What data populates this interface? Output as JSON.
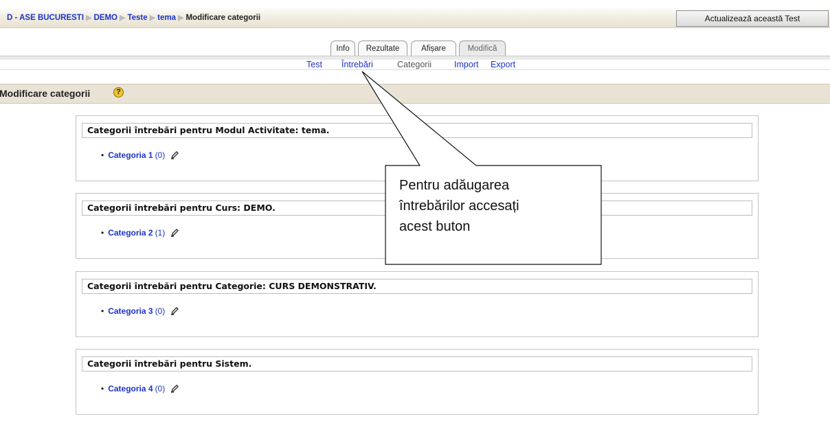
{
  "breadcrumb": {
    "items": [
      "D - ASE BUCURESTI",
      "DEMO",
      "Teste",
      "tema"
    ],
    "current": "Modificare categorii"
  },
  "header": {
    "update_button": "Actualizează această Test"
  },
  "tabs": [
    "Info",
    "Rezultate",
    "Afișare",
    "Modifică"
  ],
  "subtabs": [
    "Test",
    "Întrebări",
    "Categorii",
    "Import",
    "Export"
  ],
  "page_title": "Modificare categorii",
  "help_icon": "?",
  "sections": [
    {
      "title": "Categorii întrebări pentru Modul Activitate: tema.",
      "category": "Categoria 1",
      "count": "(0)"
    },
    {
      "title": "Categorii întrebări pentru Curs: DEMO.",
      "category": "Categoria 2",
      "count": "(1)"
    },
    {
      "title": "Categorii întrebări pentru Categorie: CURS DEMONSTRATIV.",
      "category": "Categoria 3",
      "count": "(0)"
    },
    {
      "title": "Categorii întrebări pentru Sistem.",
      "category": "Categoria 4",
      "count": "(0)"
    }
  ],
  "callout": {
    "text": [
      "Pentru adăugarea",
      "întrebărilor accesați",
      "acest buton"
    ]
  },
  "icons": {
    "edit": "edit-pencil-icon",
    "help": "help-icon"
  },
  "colors": {
    "link": "#1b33c8",
    "band": "#e9e3d5"
  }
}
